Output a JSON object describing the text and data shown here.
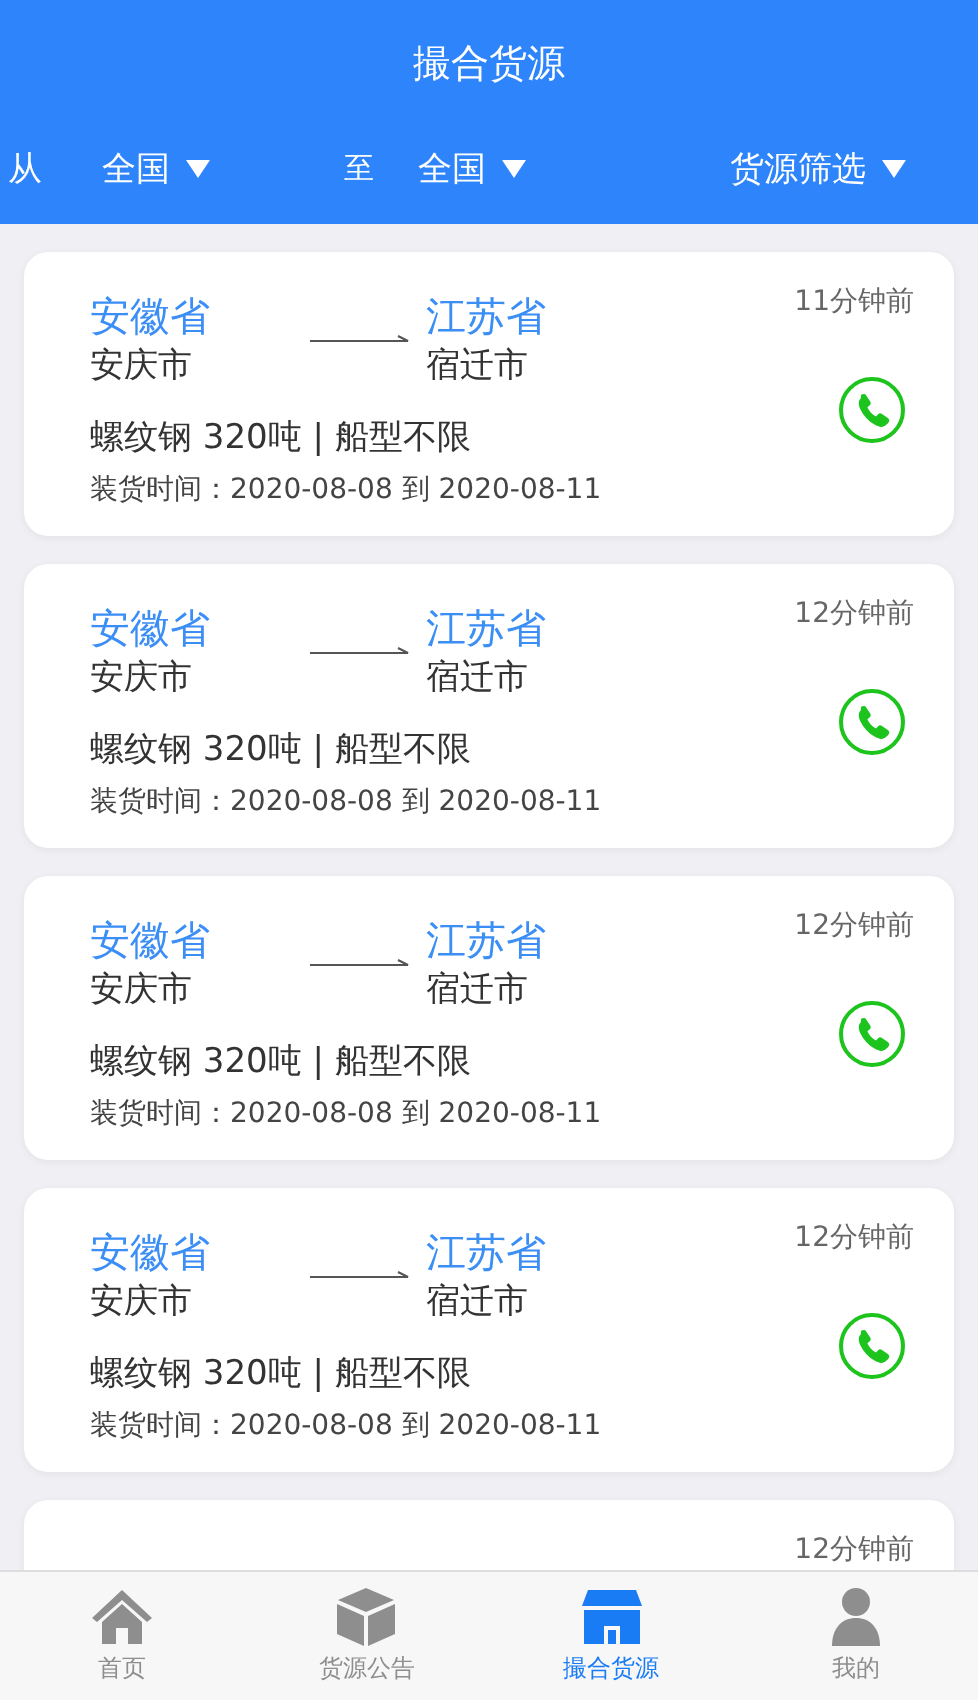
{
  "header": {
    "title": "撮合货源"
  },
  "filters": [
    {
      "kind": "label",
      "text": "从"
    },
    {
      "kind": "dropdown",
      "text": "全国"
    },
    {
      "kind": "label",
      "text": "至"
    },
    {
      "kind": "dropdown",
      "text": "全国"
    },
    {
      "kind": "dropdown",
      "text": "货源筛选"
    }
  ],
  "cards": [
    {
      "from_province": "安徽省",
      "from_city": "安庆市",
      "to_province": "江苏省",
      "to_city": "宿迁市",
      "time": "11分钟前",
      "cargo": "螺纹钢 320吨 | 船型不限",
      "loading": "装货时间：2020-08-08 到 2020-08-11"
    },
    {
      "from_province": "安徽省",
      "from_city": "安庆市",
      "to_province": "江苏省",
      "to_city": "宿迁市",
      "time": "12分钟前",
      "cargo": "螺纹钢 320吨 | 船型不限",
      "loading": "装货时间：2020-08-08 到 2020-08-11"
    },
    {
      "from_province": "安徽省",
      "from_city": "安庆市",
      "to_province": "江苏省",
      "to_city": "宿迁市",
      "time": "12分钟前",
      "cargo": "螺纹钢 320吨 | 船型不限",
      "loading": "装货时间：2020-08-08 到 2020-08-11"
    },
    {
      "from_province": "安徽省",
      "from_city": "安庆市",
      "to_province": "江苏省",
      "to_city": "宿迁市",
      "time": "12分钟前",
      "cargo": "螺纹钢 320吨 | 船型不限",
      "loading": "装货时间：2020-08-08 到 2020-08-11"
    },
    {
      "time": "12分钟前"
    }
  ],
  "tab_bar": [
    {
      "kind": "home",
      "label": "首页",
      "selected": false
    },
    {
      "kind": "box",
      "label": "货源公告",
      "selected": false
    },
    {
      "kind": "store",
      "label": "撮合货源",
      "selected": true
    },
    {
      "kind": "person",
      "label": "我的",
      "selected": false
    }
  ]
}
